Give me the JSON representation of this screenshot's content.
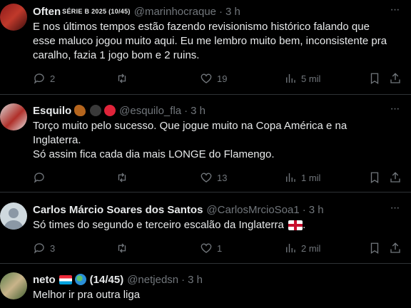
{
  "tweets": [
    {
      "name": "Often",
      "name_suffix": "SÉRIE B 2025 (10/45)",
      "handle": "@marinhocraque",
      "time": "3 h",
      "text": [
        "E nos últimos tempos estão fazendo revisionismo histórico falando que",
        "esse maluco jogou muito aqui. Eu me lembro muito bem, inconsistente pra",
        "caralho, fazia 1 jogo bom e 2 ruins."
      ],
      "replies": "2",
      "retweets": "",
      "likes": "19",
      "views": "5 mil"
    },
    {
      "name": "Esquilo",
      "handle": "@esquilo_fla",
      "time": "3 h",
      "text": [
        "Torço muito pelo sucesso. Que jogue muito na Copa América e na",
        "Inglaterra.",
        "Só assim fica cada dia mais LONGE do Flamengo."
      ],
      "replies": "",
      "retweets": "",
      "likes": "13",
      "views": "1 mil"
    },
    {
      "name": "Carlos Márcio Soares dos Santos",
      "handle": "@CarlosMrcioSoa1",
      "time": "3 h",
      "text": [
        "Só times do segundo e terceiro escalão da Inglaterra"
      ],
      "replies": "3",
      "retweets": "",
      "likes": "1",
      "views": "2 mil"
    },
    {
      "name": "neto",
      "name_suffix": "(14/45)",
      "handle": "@netjedsn",
      "time": "3 h",
      "text": [
        "Melhor ir pra outra liga"
      ]
    }
  ],
  "icons": {
    "reply": "reply-icon",
    "retweet": "retweet-icon",
    "like": "heart-icon",
    "views": "views-chart-icon",
    "bookmark": "bookmark-icon",
    "share": "share-icon",
    "more": "more-options-icon"
  },
  "colors": {
    "background": "#000000",
    "text": "#e7e9ea",
    "muted": "#71767b",
    "border": "#2f3336"
  }
}
